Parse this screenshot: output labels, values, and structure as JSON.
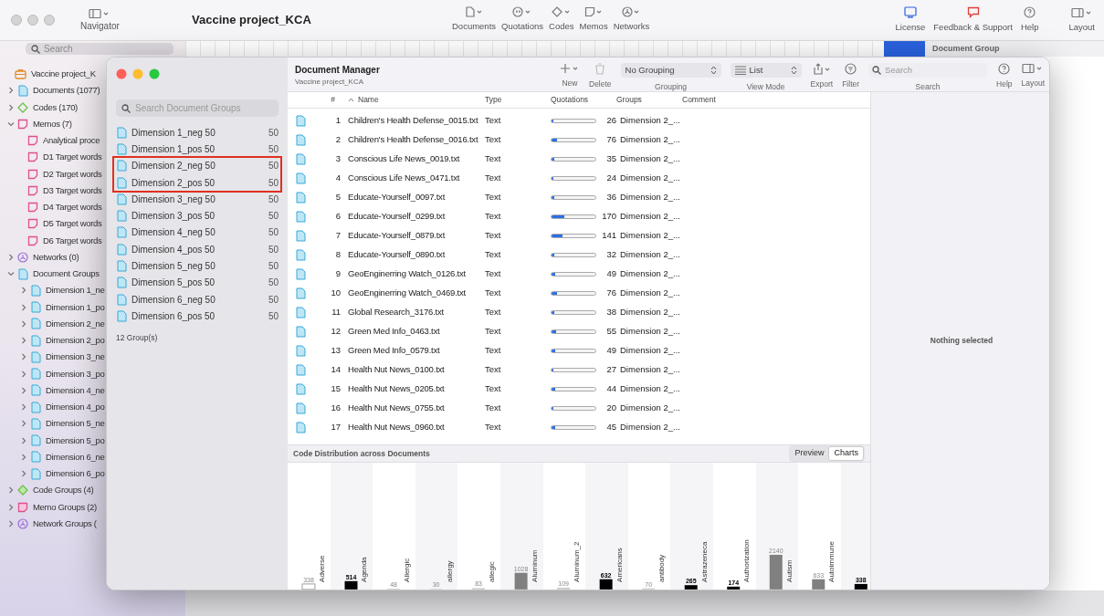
{
  "app_toolbar": {
    "navigator_label": "Navigator",
    "title": "Vaccine project_KCA",
    "nav_buttons": [
      {
        "kind": "documents",
        "label": "Documents"
      },
      {
        "kind": "quotations",
        "label": "Quotations"
      },
      {
        "kind": "codes",
        "label": "Codes"
      },
      {
        "kind": "memos",
        "label": "Memos"
      },
      {
        "kind": "networks",
        "label": "Networks"
      }
    ],
    "right_buttons": [
      {
        "kind": "license",
        "label": "License"
      },
      {
        "kind": "feedback",
        "label": "Feedback & Support"
      },
      {
        "kind": "help",
        "label": "Help"
      },
      {
        "kind": "layout",
        "label": "Layout"
      }
    ]
  },
  "sidebar": {
    "search": {
      "placeholder": "Search"
    },
    "items": [
      {
        "kind": "project",
        "label": "Vaccine project_K"
      },
      {
        "kind": "documents",
        "label": "Documents (1077)",
        "expanded": false
      },
      {
        "kind": "codes",
        "label": "Codes (170)",
        "expanded": false
      },
      {
        "kind": "memos",
        "label": "Memos (7)",
        "expanded": true,
        "children": [
          {
            "kind": "memo",
            "label": "Analytical proce"
          },
          {
            "kind": "memo",
            "label": "D1 Target words"
          },
          {
            "kind": "memo",
            "label": "D2 Target words"
          },
          {
            "kind": "memo",
            "label": "D3 Target words"
          },
          {
            "kind": "memo",
            "label": "D4 Target words"
          },
          {
            "kind": "memo",
            "label": "D5 Target words"
          },
          {
            "kind": "memo",
            "label": "D6 Target words"
          }
        ]
      },
      {
        "kind": "networks",
        "label": "Networks (0)",
        "expanded": false
      },
      {
        "kind": "document_groups",
        "label": "Document Groups",
        "expanded": true,
        "children": [
          {
            "kind": "document_group",
            "label": "Dimension 1_ne",
            "expanded": false
          },
          {
            "kind": "document_group",
            "label": "Dimension 1_po",
            "expanded": false
          },
          {
            "kind": "document_group",
            "label": "Dimension 2_ne",
            "expanded": false
          },
          {
            "kind": "document_group",
            "label": "Dimension 2_po",
            "expanded": false
          },
          {
            "kind": "document_group",
            "label": "Dimension 3_ne",
            "expanded": false
          },
          {
            "kind": "document_group",
            "label": "Dimension 3_po",
            "expanded": false
          },
          {
            "kind": "document_group",
            "label": "Dimension 4_ne",
            "expanded": false
          },
          {
            "kind": "document_group",
            "label": "Dimension 4_po",
            "expanded": false
          },
          {
            "kind": "document_group",
            "label": "Dimension 5_ne",
            "expanded": false
          },
          {
            "kind": "document_group",
            "label": "Dimension 5_po",
            "expanded": false
          },
          {
            "kind": "document_group",
            "label": "Dimension 6_ne",
            "expanded": false
          },
          {
            "kind": "document_group",
            "label": "Dimension 6_po",
            "expanded": false
          }
        ]
      },
      {
        "kind": "code_groups",
        "label": "Code Groups (4)",
        "expanded": false
      },
      {
        "kind": "memo_groups",
        "label": "Memo Groups (2)",
        "expanded": false
      },
      {
        "kind": "network_groups",
        "label": "Network Groups (",
        "expanded": false
      }
    ]
  },
  "background_panel": {
    "header": "Document Group"
  },
  "document_groups_panel": {
    "search": {
      "placeholder": "Search Document Groups"
    },
    "groups": [
      {
        "name": "Dimension 1_neg 50",
        "count": "50",
        "highlighted": false
      },
      {
        "name": "Dimension 1_pos 50",
        "count": "50",
        "highlighted": false
      },
      {
        "name": "Dimension 2_neg 50",
        "count": "50",
        "highlighted": true
      },
      {
        "name": "Dimension 2_pos 50",
        "count": "50",
        "highlighted": true
      },
      {
        "name": "Dimension 3_neg 50",
        "count": "50",
        "highlighted": false
      },
      {
        "name": "Dimension 3_pos 50",
        "count": "50",
        "highlighted": false
      },
      {
        "name": "Dimension 4_neg 50",
        "count": "50",
        "highlighted": false
      },
      {
        "name": "Dimension 4_pos 50",
        "count": "50",
        "highlighted": false
      },
      {
        "name": "Dimension 5_neg 50",
        "count": "50",
        "highlighted": false
      },
      {
        "name": "Dimension 5_pos 50",
        "count": "50",
        "highlighted": false
      },
      {
        "name": "Dimension 6_neg 50",
        "count": "50",
        "highlighted": false
      },
      {
        "name": "Dimension 6_pos 50",
        "count": "50",
        "highlighted": false
      }
    ],
    "footer": "12 Group(s)"
  },
  "document_manager": {
    "title": "Document Manager",
    "subtitle": "Vaccine project_KCA",
    "toolbar": [
      {
        "kind": "new",
        "label": "New"
      },
      {
        "kind": "delete",
        "label": "Delete"
      },
      {
        "kind": "grouping",
        "value": "No Grouping",
        "label": "Grouping"
      },
      {
        "kind": "view_mode",
        "value": "List",
        "label": "View Mode"
      },
      {
        "kind": "export",
        "label": "Export"
      },
      {
        "kind": "filter",
        "label": "Filter"
      },
      {
        "kind": "search",
        "placeholder": "Search",
        "label": "Search"
      },
      {
        "kind": "help",
        "label": "Help"
      },
      {
        "kind": "layout",
        "label": "Layout"
      }
    ],
    "table": {
      "columns": [
        "#",
        "Name",
        "Type",
        "Quotations",
        "Groups",
        "Comment"
      ],
      "rows": [
        {
          "number": "1",
          "name": "Children's Health Defense_0015.txt",
          "type": "Text",
          "level": 0.05,
          "quotations": "26",
          "groups": "Dimension 2_..."
        },
        {
          "number": "2",
          "name": "Children's Health Defense_0016.txt",
          "type": "Text",
          "level": 0.13,
          "quotations": "76",
          "groups": "Dimension 2_..."
        },
        {
          "number": "3",
          "name": "Conscious Life News_0019.txt",
          "type": "Text",
          "level": 0.06,
          "quotations": "35",
          "groups": "Dimension 2_..."
        },
        {
          "number": "4",
          "name": "Conscious Life News_0471.txt",
          "type": "Text",
          "level": 0.04,
          "quotations": "24",
          "groups": "Dimension 2_..."
        },
        {
          "number": "5",
          "name": "Educate-Yourself_0097.txt",
          "type": "Text",
          "level": 0.06,
          "quotations": "36",
          "groups": "Dimension 2_..."
        },
        {
          "number": "6",
          "name": "Educate-Yourself_0299.txt",
          "type": "Text",
          "level": 0.3,
          "quotations": "170",
          "groups": "Dimension 2_..."
        },
        {
          "number": "7",
          "name": "Educate-Yourself_0879.txt",
          "type": "Text",
          "level": 0.25,
          "quotations": "141",
          "groups": "Dimension 2_..."
        },
        {
          "number": "8",
          "name": "Educate-Yourself_0890.txt",
          "type": "Text",
          "level": 0.06,
          "quotations": "32",
          "groups": "Dimension 2_..."
        },
        {
          "number": "9",
          "name": "GeoEnginerring Watch_0126.txt",
          "type": "Text",
          "level": 0.09,
          "quotations": "49",
          "groups": "Dimension 2_..."
        },
        {
          "number": "10",
          "name": "GeoEnginerring Watch_0469.txt",
          "type": "Text",
          "level": 0.13,
          "quotations": "76",
          "groups": "Dimension 2_..."
        },
        {
          "number": "11",
          "name": "Global Research_3176.txt",
          "type": "Text",
          "level": 0.07,
          "quotations": "38",
          "groups": "Dimension 2_..."
        },
        {
          "number": "12",
          "name": "Green Med Info_0463.txt",
          "type": "Text",
          "level": 0.1,
          "quotations": "55",
          "groups": "Dimension 2_..."
        },
        {
          "number": "13",
          "name": "Green Med Info_0579.txt",
          "type": "Text",
          "level": 0.09,
          "quotations": "49",
          "groups": "Dimension 2_..."
        },
        {
          "number": "14",
          "name": "Health Nut News_0100.txt",
          "type": "Text",
          "level": 0.05,
          "quotations": "27",
          "groups": "Dimension 2_..."
        },
        {
          "number": "15",
          "name": "Health Nut News_0205.txt",
          "type": "Text",
          "level": 0.08,
          "quotations": "44",
          "groups": "Dimension 2_..."
        },
        {
          "number": "16",
          "name": "Health Nut News_0755.txt",
          "type": "Text",
          "level": 0.04,
          "quotations": "20",
          "groups": "Dimension 2_..."
        },
        {
          "number": "17",
          "name": "Health Nut News_0960.txt",
          "type": "Text",
          "level": 0.08,
          "quotations": "45",
          "groups": "Dimension 2_..."
        }
      ]
    },
    "code_distribution": {
      "title": "Code Distribution across Documents",
      "tabs": [
        {
          "label": "Preview",
          "selected": false
        },
        {
          "label": "Charts",
          "selected": true
        }
      ],
      "chart_data": {
        "type": "bar",
        "categories": [
          "Adverse",
          "Agenda",
          "Allergic",
          "allergy",
          "allegic",
          "Aluminum",
          "Aluminum_2",
          "Americans",
          "antibody",
          "Astrazeneca",
          "Authorization",
          "Autism",
          "Autoimmune",
          null
        ],
        "series": [
          {
            "color": "#ffffff",
            "values": [
              338,
              null,
              null,
              null,
              null,
              null,
              null,
              null,
              null,
              null,
              null,
              null,
              null,
              null
            ]
          },
          {
            "color": "#000000",
            "values": [
              null,
              514,
              null,
              null,
              null,
              null,
              null,
              632,
              null,
              265,
              174,
              null,
              null,
              338
            ]
          },
          {
            "color": "#808080",
            "values": [
              null,
              null,
              null,
              null,
              null,
              1028,
              null,
              null,
              null,
              null,
              null,
              2140,
              633,
              null
            ]
          },
          {
            "color": "#cccccc",
            "values": [
              null,
              null,
              48,
              30,
              83,
              null,
              109,
              null,
              70,
              null,
              null,
              null,
              null,
              null
            ]
          }
        ],
        "stacked": true,
        "data_labels": true
      }
    },
    "inspector": {
      "message": "Nothing selected"
    }
  }
}
